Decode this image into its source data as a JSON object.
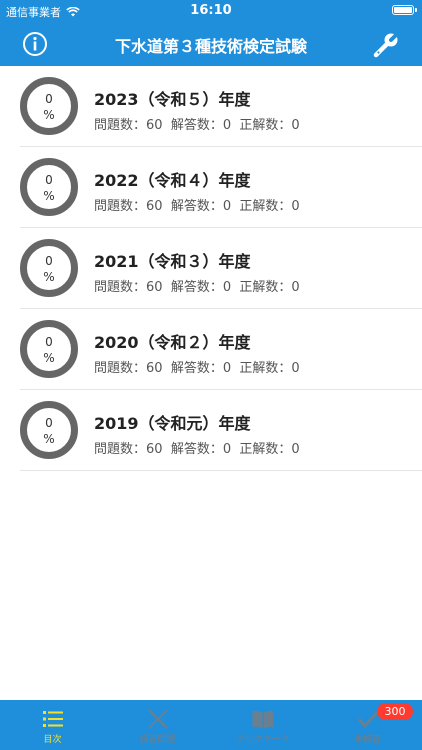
{
  "status_bar": {
    "carrier": "通信事業者",
    "time": "16:10",
    "battery_level": 1.0
  },
  "header": {
    "title": "下水道第３種技術検定試験",
    "left_icon": "info-icon",
    "right_icon": "wrench-icon"
  },
  "exams": [
    {
      "year": "2023（令和５）年度",
      "progress_top": "0",
      "progress_bottom": "%",
      "questions": "問題数：60",
      "answered": "解答数：0",
      "correct": "正解数：0"
    },
    {
      "year": "2022（令和４）年度",
      "progress_top": "0",
      "progress_bottom": "%",
      "questions": "問題数：60",
      "answered": "解答数：0",
      "correct": "正解数：0"
    },
    {
      "year": "2021（令和３）年度",
      "progress_top": "0",
      "progress_bottom": "%",
      "questions": "問題数：60",
      "answered": "解答数：0",
      "correct": "正解数：0"
    },
    {
      "year": "2020（令和２）年度",
      "progress_top": "0",
      "progress_bottom": "%",
      "questions": "問題数：60",
      "answered": "解答数：0",
      "correct": "正解数：0"
    },
    {
      "year": "2019（令和元）年度",
      "progress_top": "0",
      "progress_bottom": "%",
      "questions": "問題数：60",
      "answered": "解答数：0",
      "correct": "正解数：0"
    }
  ],
  "tabbar": {
    "tabs": [
      {
        "label": "目次",
        "icon": "list-icon",
        "active": true
      },
      {
        "label": "誤答問題",
        "icon": "x-mark-icon",
        "active": false
      },
      {
        "label": "ブックマーク",
        "icon": "book-icon",
        "active": false
      },
      {
        "label": "未解答",
        "icon": "checkmark-icon",
        "active": false,
        "badge": "300"
      }
    ]
  },
  "colors": {
    "primary": "#1f8fdb",
    "active_tab": "#f5e025",
    "inactive_tab": "#6a7f90",
    "badge": "#ff3b30",
    "ring": "#666666"
  }
}
